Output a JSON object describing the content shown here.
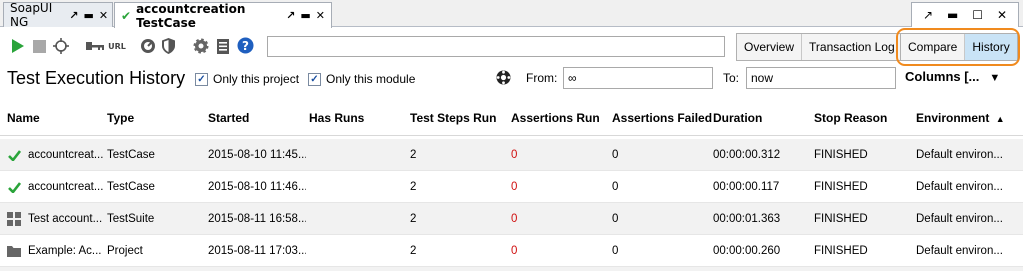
{
  "tabs": [
    {
      "label": "SoapUI NG",
      "controls": [
        "↗",
        "▬",
        "✕"
      ]
    },
    {
      "label": "accountcreation TestCase",
      "controls": [
        "↗",
        "▬",
        "✕"
      ]
    }
  ],
  "window_controls": [
    "↗",
    "▬",
    "☐",
    "✕"
  ],
  "toolbar": {
    "url_label": "URL",
    "search_value": "",
    "view_buttons": [
      "Overview",
      "Transaction Log",
      "Compare",
      "History"
    ],
    "selected_view": "History"
  },
  "filter": {
    "title": "Test Execution History",
    "only_project_label": "Only this project",
    "only_module_label": "Only this module",
    "only_project_checked": true,
    "only_module_checked": true,
    "from_label": "From:",
    "from_value": "∞",
    "to_label": "To:",
    "to_value": "now",
    "columns_label": "Columns [..."
  },
  "table": {
    "headers": [
      "Name",
      "Type",
      "Started",
      "Has Runs",
      "Test Steps Run",
      "Assertions Run",
      "Assertions Failed",
      "Duration",
      "Stop Reason",
      "Environment"
    ],
    "sort_indicator": "▲",
    "rows": [
      {
        "icon": "check-icon",
        "name": "accountcreat...",
        "type": "TestCase",
        "started": "2015-08-10 11:45...",
        "has_runs": "",
        "steps": "2",
        "assertions_run": "0",
        "assertions_failed": "0",
        "duration": "00:00:00.312",
        "stop": "FINISHED",
        "env": "Default environ..."
      },
      {
        "icon": "check-icon",
        "name": "accountcreat...",
        "type": "TestCase",
        "started": "2015-08-10 11:46...",
        "has_runs": "",
        "steps": "2",
        "assertions_run": "0",
        "assertions_failed": "0",
        "duration": "00:00:00.117",
        "stop": "FINISHED",
        "env": "Default environ..."
      },
      {
        "icon": "grid-icon",
        "name": "Test account...",
        "type": "TestSuite",
        "started": "2015-08-11 16:58...",
        "has_runs": "",
        "steps": "2",
        "assertions_run": "0",
        "assertions_failed": "0",
        "duration": "00:00:01.363",
        "stop": "FINISHED",
        "env": "Default environ..."
      },
      {
        "icon": "folder-icon",
        "name": "Example: Ac...",
        "type": "Project",
        "started": "2015-08-11 17:03...",
        "has_runs": "",
        "steps": "2",
        "assertions_run": "0",
        "assertions_failed": "0",
        "duration": "00:00:00.260",
        "stop": "FINISHED",
        "env": "Default environ..."
      }
    ]
  },
  "colors": {
    "accent": "#2aa43a",
    "highlight": "#f08a1e",
    "selected": "#c9e3f6",
    "error": "#d01010"
  }
}
